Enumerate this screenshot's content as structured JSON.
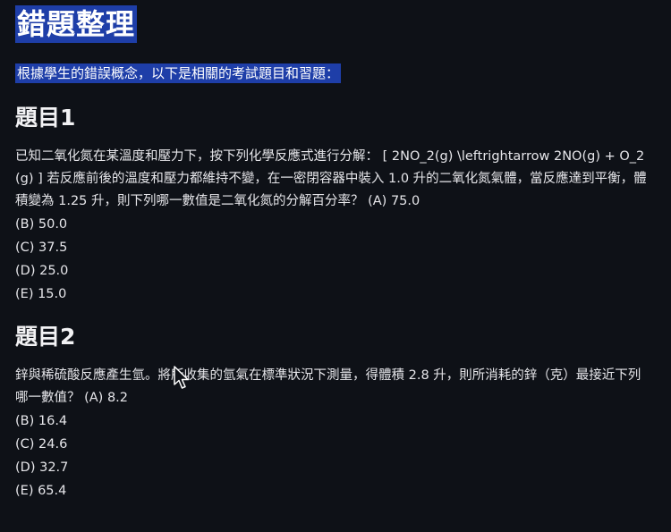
{
  "page": {
    "title": "錯題整理",
    "intro": "根據學生的錯誤概念，以下是相關的考試題目和習題："
  },
  "questions": [
    {
      "heading": "題目1",
      "text": "已知二氧化氮在某溫度和壓力下，按下列化學反應式進行分解： [ 2NO_2(g) \\leftrightarrow 2NO(g) + O_2(g) ] 若反應前後的溫度和壓力都維持不變，在一密閉容器中裝入 1.0 升的二氧化氮氣體，當反應達到平衡，體積變為 1.25 升，則下列哪一數值是二氧化氮的分解百分率？ (A) 75.0",
      "options": [
        "(B) 50.0",
        "(C) 37.5",
        "(D) 25.0",
        "(E) 15.0"
      ]
    },
    {
      "heading": "題目2",
      "text": "鋅與稀硫酸反應產生氫。將所收集的氫氣在標準狀況下測量，得體積 2.8 升，則所消耗的鋅（克）最接近下列哪一數值？ (A) 8.2",
      "options": [
        "(B) 16.4",
        "(C) 24.6",
        "(D) 32.7",
        "(E) 65.4"
      ]
    }
  ],
  "colors": {
    "background": "#0e1117",
    "highlight": "#1e3ea8",
    "text": "#e6e6ea"
  },
  "icons": {
    "cursor": "mouse-pointer-icon"
  }
}
